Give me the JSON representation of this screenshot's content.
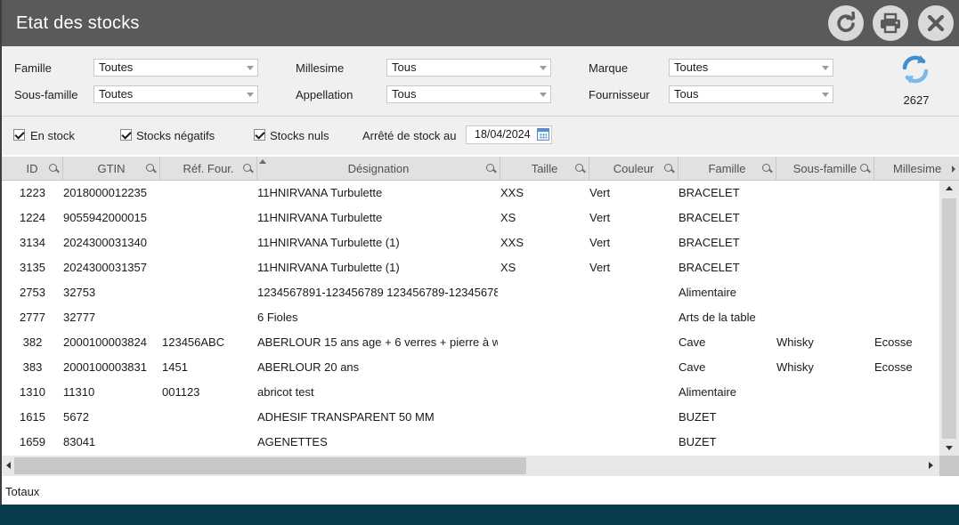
{
  "window": {
    "title": "Etat des stocks"
  },
  "toolbar": {
    "buttons": [
      {
        "name": "reload-button",
        "icon": "reload-icon"
      },
      {
        "name": "print-button",
        "icon": "printer-icon"
      },
      {
        "name": "close-button",
        "icon": "close-icon"
      }
    ]
  },
  "filters": {
    "famille": {
      "label": "Famille",
      "value": "Toutes"
    },
    "sous_famille": {
      "label": "Sous-famille",
      "value": "Toutes"
    },
    "millesime": {
      "label": "Millesime",
      "value": "Tous"
    },
    "appellation": {
      "label": "Appellation",
      "value": "Tous"
    },
    "marque": {
      "label": "Marque",
      "value": "Toutes"
    },
    "fournisseur": {
      "label": "Fournisseur",
      "value": "Tous"
    },
    "count": "2627"
  },
  "options": {
    "en_stock": {
      "label": "En stock",
      "checked": true
    },
    "stocks_negatifs": {
      "label": "Stocks négatifs",
      "checked": true
    },
    "stocks_nuls": {
      "label": "Stocks nuls",
      "checked": true
    },
    "arrete_label": "Arrêté de stock au",
    "arrete_date": "18/04/2024"
  },
  "grid": {
    "columns": [
      "ID",
      "GTIN",
      "Réf. Four.",
      "Désignation",
      "Taille",
      "Couleur",
      "Famille",
      "Sous-famille",
      "Millesime"
    ],
    "rows": [
      [
        "1223",
        "2018000012235",
        "",
        "11HNIRVANA Turbulette",
        "XXS",
        "Vert",
        "BRACELET",
        "",
        ""
      ],
      [
        "1224",
        "9055942000015",
        "",
        "11HNIRVANA Turbulette",
        "XS",
        "Vert",
        "BRACELET",
        "",
        ""
      ],
      [
        "3134",
        "2024300031340",
        "",
        "11HNIRVANA Turbulette (1)",
        "XXS",
        "Vert",
        "BRACELET",
        "",
        ""
      ],
      [
        "3135",
        "2024300031357",
        "",
        "11HNIRVANA Turbulette (1)",
        "XS",
        "Vert",
        "BRACELET",
        "",
        ""
      ],
      [
        "2753",
        "32753",
        "",
        "1234567891-123456789 123456789-12345678-",
        "",
        "",
        "Alimentaire",
        "",
        ""
      ],
      [
        "2777",
        "32777",
        "",
        "6 Fioles",
        "",
        "",
        "Arts de la table",
        "",
        ""
      ],
      [
        "382",
        "2000100003824",
        "123456ABC",
        "ABERLOUR 15 ans age + 6 verres + pierre à w",
        "",
        "",
        "Cave",
        "Whisky",
        "Ecosse"
      ],
      [
        "383",
        "2000100003831",
        "1451",
        "ABERLOUR 20 ans",
        "",
        "",
        "Cave",
        "Whisky",
        "Ecosse"
      ],
      [
        "1310",
        "11310",
        "001123",
        "abricot    test",
        "",
        "",
        "Alimentaire",
        "",
        ""
      ],
      [
        "1615",
        "5672",
        "",
        "ADHESIF TRANSPARENT 50 MM",
        "",
        "",
        "BUZET",
        "",
        ""
      ],
      [
        "1659",
        "83041",
        "",
        "AGENETTES",
        "",
        "",
        "BUZET",
        "",
        ""
      ]
    ]
  },
  "totals": {
    "label": "Totaux"
  },
  "colors": {
    "titlebar": "#5a5a5a",
    "panel": "#f0f0f0",
    "footer": "#073d4e",
    "accent": "#3f8fd0"
  }
}
